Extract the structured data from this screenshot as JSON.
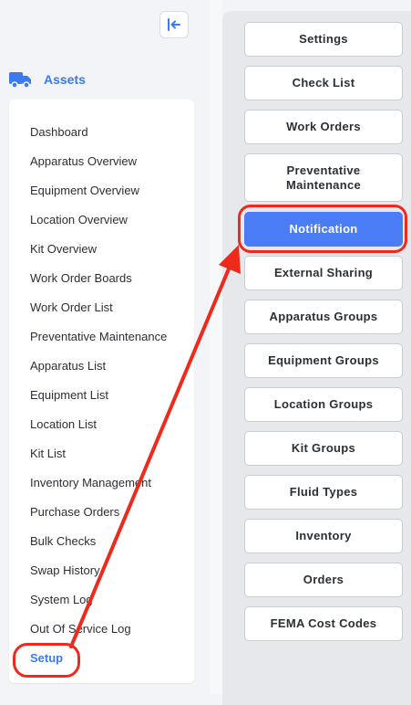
{
  "sidebar": {
    "section_title": "Assets",
    "section_icon": "truck-icon",
    "collapse_icon": "collapse-left-icon",
    "items": [
      {
        "label": "Dashboard"
      },
      {
        "label": "Apparatus Overview"
      },
      {
        "label": "Equipment Overview"
      },
      {
        "label": "Location Overview"
      },
      {
        "label": "Kit Overview"
      },
      {
        "label": "Work Order Boards"
      },
      {
        "label": "Work Order List"
      },
      {
        "label": "Preventative Maintenance"
      },
      {
        "label": "Apparatus List"
      },
      {
        "label": "Equipment List"
      },
      {
        "label": "Location List"
      },
      {
        "label": "Kit List"
      },
      {
        "label": "Inventory Management"
      },
      {
        "label": "Purchase Orders"
      },
      {
        "label": "Bulk Checks"
      },
      {
        "label": "Swap History"
      },
      {
        "label": "System Log"
      },
      {
        "label": "Out Of Service Log"
      },
      {
        "label": "Setup",
        "active": true
      }
    ]
  },
  "setup_menu": {
    "buttons": [
      {
        "label": "Settings"
      },
      {
        "label": "Check List"
      },
      {
        "label": "Work Orders"
      },
      {
        "label": "Preventative Maintenance"
      },
      {
        "label": "Notification",
        "active": true
      },
      {
        "label": "External Sharing"
      },
      {
        "label": "Apparatus Groups"
      },
      {
        "label": "Equipment Groups"
      },
      {
        "label": "Location Groups"
      },
      {
        "label": "Kit Groups"
      },
      {
        "label": "Fluid Types"
      },
      {
        "label": "Inventory"
      },
      {
        "label": "Orders"
      },
      {
        "label": "FEMA Cost Codes"
      }
    ]
  },
  "colors": {
    "accent": "#3b7af0",
    "active_button": "#4a7cf6",
    "annotation": "#ee2a1d"
  }
}
